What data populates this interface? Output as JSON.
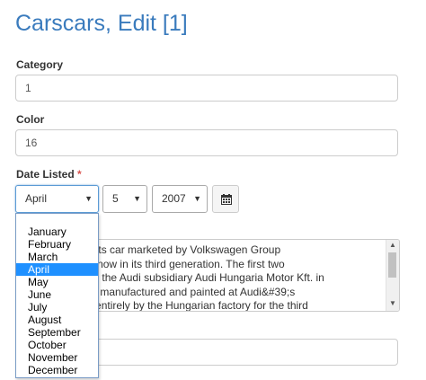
{
  "page": {
    "title": "Carscars, Edit [1]"
  },
  "fields": {
    "category": {
      "label": "Category",
      "value": "1"
    },
    "color": {
      "label": "Color",
      "value": "16"
    },
    "date_listed": {
      "label": "Date Listed",
      "required_mark": "*",
      "month": "April",
      "day": "5",
      "year": "2007"
    },
    "description": {
      "lines": [
        "is a 2-door sports car marketed by Volkswagen Group",
        "ince 1998, and now in its third generation. The first two",
        "e assembled by the Audi subsidiary Audi Hungaria Motor Kft. in",
        "sing bodyshells manufactured and painted at Audi&#39;s",
        "nd parts made entirely by the Hungarian factory for the third"
      ]
    }
  },
  "month_dropdown": {
    "options": [
      "January",
      "February",
      "March",
      "April",
      "May",
      "June",
      "July",
      "August",
      "September",
      "October",
      "November",
      "December"
    ],
    "selected": "April"
  },
  "icons": {
    "caret": "caret-down-icon",
    "calendar": "calendar-icon"
  }
}
